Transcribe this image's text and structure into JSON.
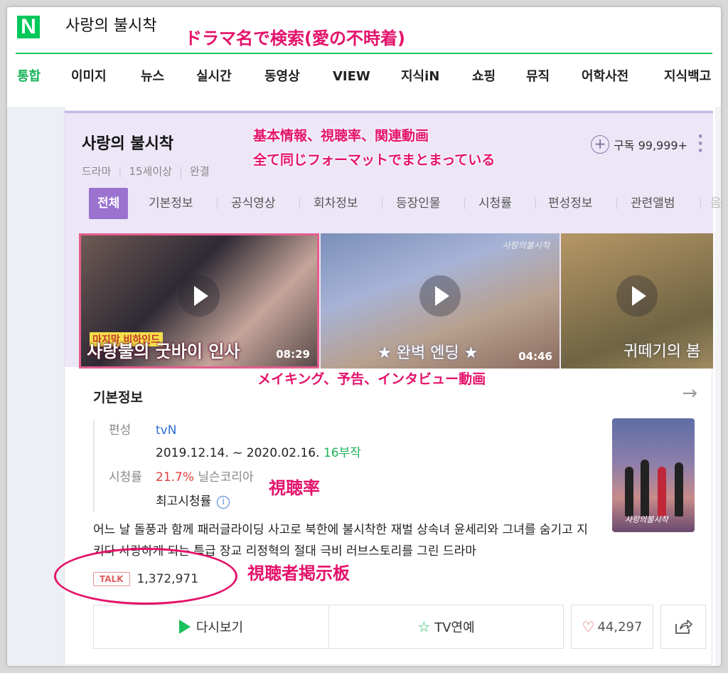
{
  "header": {
    "logo": "N",
    "query": "사랑의 불시착"
  },
  "tabs": [
    "통합",
    "이미지",
    "뉴스",
    "실시간",
    "동영상",
    "VIEW",
    "지식iN",
    "쇼핑",
    "뮤직",
    "어학사전",
    "지식백고"
  ],
  "card": {
    "title": "사랑의 불시착",
    "meta": [
      "드라마",
      "15세이상",
      "완결"
    ],
    "subscribe_label": "구독 99,999+",
    "subtabs": [
      "전체",
      "기본정보",
      "공식영상",
      "회차정보",
      "등장인물",
      "시청률",
      "편성정보",
      "관련앨범",
      "음"
    ]
  },
  "videos": [
    {
      "subcaption": "마지막 비하인드",
      "caption": "사랑불의 굿바이 인사",
      "duration": "08:29"
    },
    {
      "caption": "★ 완벽 엔딩 ★",
      "duration": "04:46",
      "tag": "사랑의불시착"
    },
    {
      "caption": "귀떼기의 봄"
    }
  ],
  "info": {
    "section_title": "기본정보",
    "channel_label": "편성",
    "channel": "tvN",
    "period": "2019.12.14. ~ 2020.02.16.",
    "episodes": "16부작",
    "rating_label": "시청률",
    "rating": "21.7%",
    "rating_source": "닐슨코리아",
    "top_rating_label": "최고시청률",
    "poster_caption": "사랑의불시착",
    "synopsis": "어느 날 돌풍과 함께 패러글라이딩 사고로 북한에 불시착한 재벌 상속녀 윤세리와 그녀를 숨기고 지키다 사랑하게 되는 특급 장교 리정혁의 절대 극비 러브스토리를 그린 드라마"
  },
  "talk": {
    "badge": "TALK",
    "count": "1,372,971"
  },
  "actions": {
    "rewatch": "다시보기",
    "tv": "TV연예",
    "likes": "44,297"
  },
  "annotations": {
    "search_note": "ドラマ名で検索(愛の不時着)",
    "format_note_1": "基本情報、視聴率、関連動画",
    "format_note_2": "全て同じフォーマットでまとまっている",
    "video_note": "メイキング、予告、インタビュー動画",
    "rating_note": "視聴率",
    "board_note": "視聴者掲示板"
  },
  "colors": {
    "naver_green": "#03c75a",
    "accent_purple": "#9b72d0",
    "annotation_pink": "#e4126b"
  }
}
